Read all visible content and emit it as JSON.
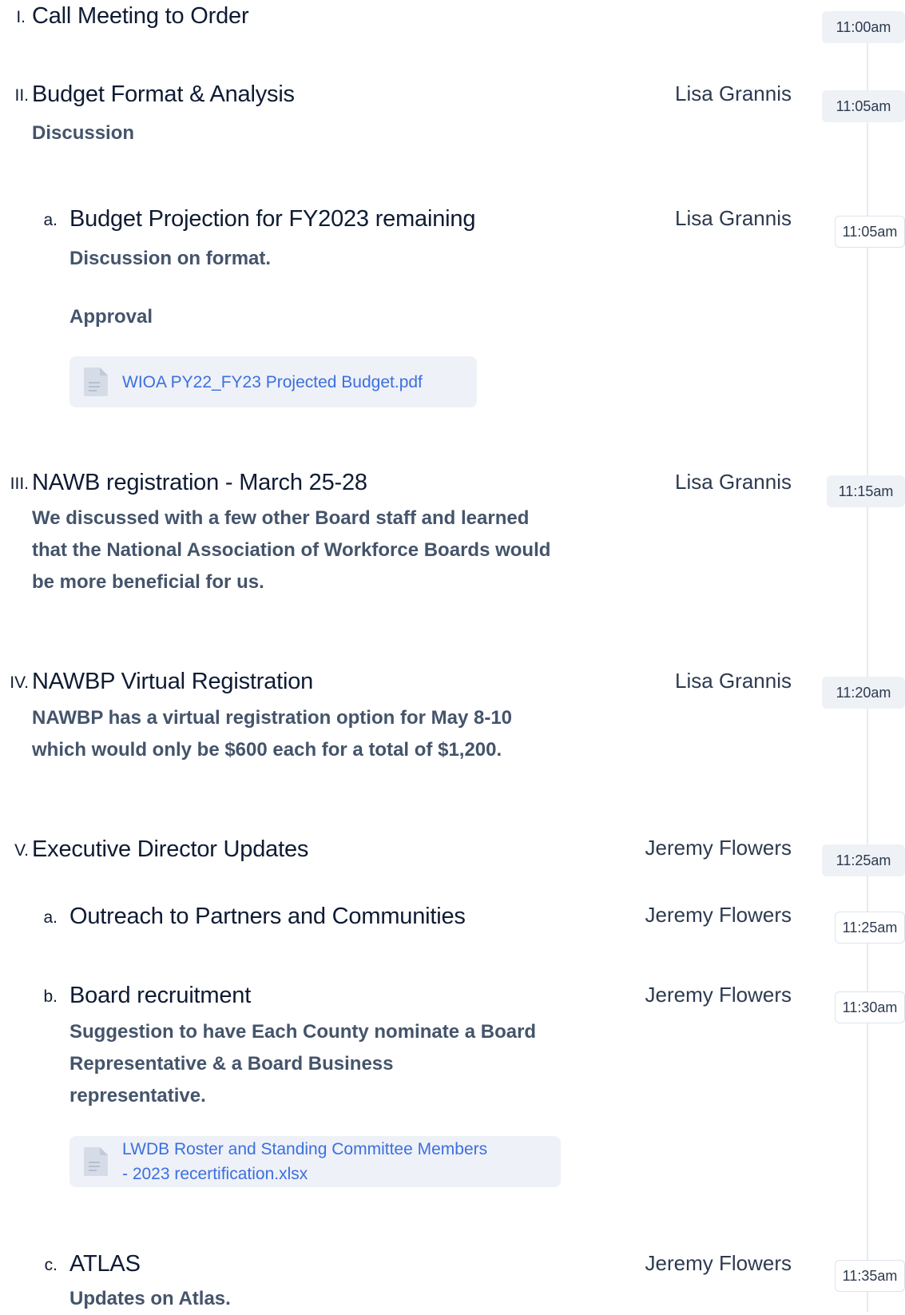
{
  "agenda": [
    {
      "num": "I.",
      "title": "Call Meeting to Order",
      "presenter": "",
      "time": "11:00am"
    },
    {
      "num": "II.",
      "title": "Budget Format & Analysis",
      "presenter": "Lisa Grannis",
      "time": "11:05am",
      "desc": "Discussion"
    },
    {
      "num": "a.",
      "title": "Budget Projection for FY2023 remaining",
      "presenter": "Lisa Grannis",
      "time": "11:05am",
      "desc1": "Discussion on format.",
      "desc2": "Approval",
      "attachment": "WIOA PY22_FY23 Projected Budget.pdf"
    },
    {
      "num": "III.",
      "title": "NAWB registration - March 25-28",
      "presenter": "Lisa Grannis",
      "time": "11:15am",
      "desc_lines": [
        "We discussed with a few other Board staff and learned",
        "that the National Association of Workforce Boards would",
        "be more beneficial for us."
      ]
    },
    {
      "num": "IV.",
      "title": "NAWBP Virtual Registration",
      "presenter": "Lisa Grannis",
      "time": "11:20am",
      "desc_lines": [
        "NAWBP has a virtual registration option for May 8-10",
        "which would only be $600 each for a total of $1,200."
      ]
    },
    {
      "num": "V.",
      "title": "Executive Director Updates",
      "presenter": "Jeremy Flowers",
      "time": "11:25am"
    },
    {
      "num": "a.",
      "title": "Outreach to Partners and Communities",
      "presenter": "Jeremy Flowers",
      "time": "11:25am"
    },
    {
      "num": "b.",
      "title": "Board recruitment",
      "presenter": "Jeremy Flowers",
      "time": "11:30am",
      "desc_lines": [
        "Suggestion to have Each County nominate a Board",
        "Representative & a Board Business",
        "representative."
      ],
      "attachment_lines": [
        "LWDB Roster and Standing Committee Members",
        "- 2023 recertification.xlsx"
      ]
    },
    {
      "num": "c.",
      "title": "ATLAS",
      "presenter": "Jeremy Flowers",
      "time": "11:35am",
      "desc": "Updates on Atlas."
    }
  ],
  "icons": {
    "attachment": "document-icon"
  },
  "colors": {
    "link": "#3b6fe0",
    "timeline": "#e6eaf1",
    "chip_bg": "#eef1f6"
  }
}
